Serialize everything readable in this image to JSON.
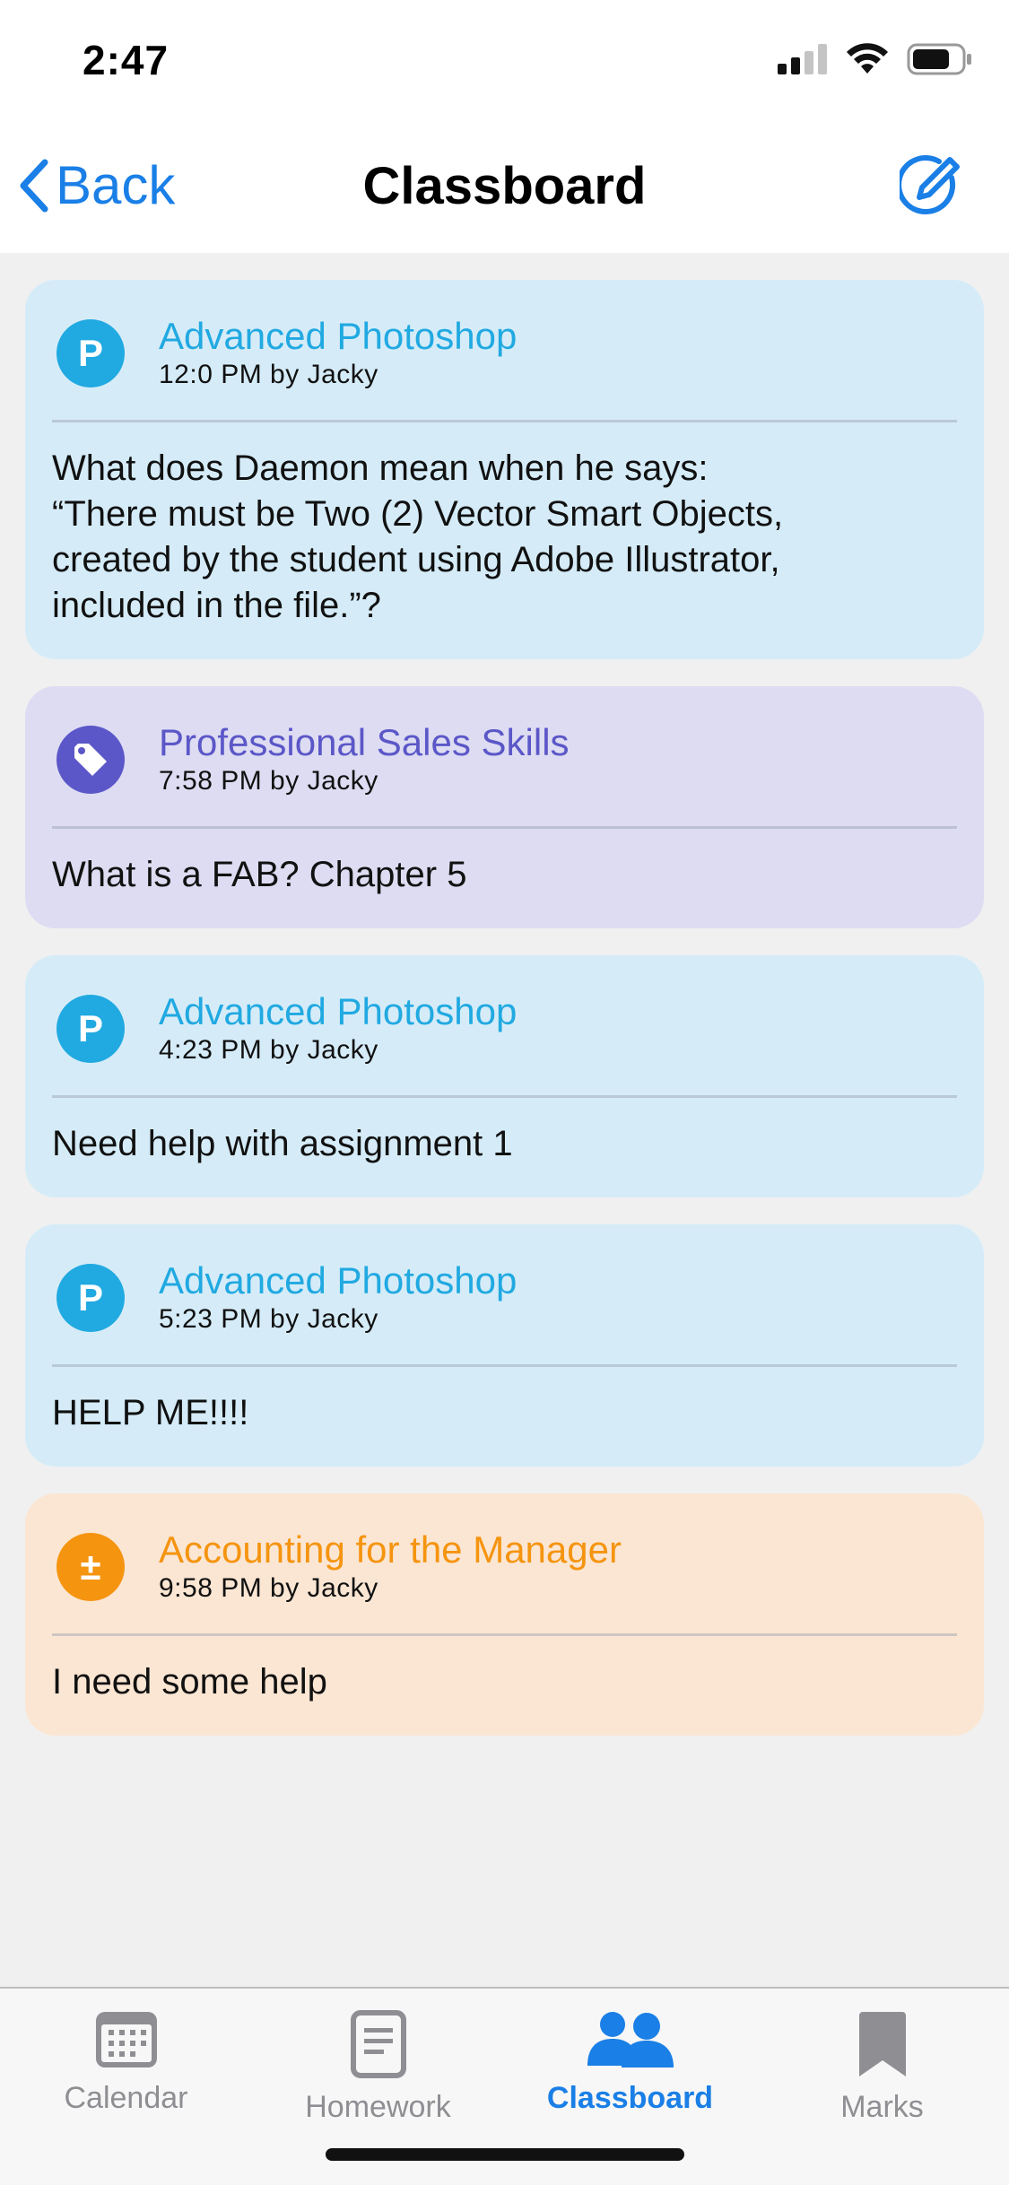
{
  "status_bar": {
    "time": "2:47"
  },
  "nav": {
    "back_label": "Back",
    "title": "Classboard"
  },
  "posts": [
    {
      "course": "Advanced Photoshop",
      "meta": "12:0 PM by Jacky",
      "avatar_letter": "P",
      "body": "What does Daemon mean when he says:\n“There must be Two (2) Vector Smart Objects,\ncreated by the student using Adobe Illustrator,\nincluded in the file.”?"
    },
    {
      "course": "Professional Sales Skills",
      "meta": "7:58 PM by Jacky",
      "avatar_icon": "tag-icon",
      "body": "What is a FAB? Chapter 5"
    },
    {
      "course": "Advanced Photoshop",
      "meta": "4:23 PM by Jacky",
      "avatar_letter": "P",
      "body": "Need help with assignment 1"
    },
    {
      "course": "Advanced Photoshop",
      "meta": "5:23 PM by Jacky",
      "avatar_letter": "P",
      "body": "HELP ME!!!!"
    },
    {
      "course": "Accounting for the Manager",
      "meta": "9:58 PM by Jacky",
      "avatar_letter": "±",
      "body": "I need some help"
    }
  ],
  "colors": {
    "accent": "#1a7fe6",
    "photoshop_card": "#d5ecf8",
    "photoshop_title": "#21a9e1",
    "sales_card": "#dddcf2",
    "sales_title": "#5b57c8",
    "accounting_card": "#fbe6d3",
    "accounting_title": "#f5940f",
    "tab_inactive": "#8e8e93"
  },
  "tabs": [
    {
      "label": "Calendar",
      "icon": "calendar-icon",
      "active": false
    },
    {
      "label": "Homework",
      "icon": "homework-icon",
      "active": false
    },
    {
      "label": "Classboard",
      "icon": "people-icon",
      "active": true
    },
    {
      "label": "Marks",
      "icon": "bookmark-icon",
      "active": false
    }
  ]
}
